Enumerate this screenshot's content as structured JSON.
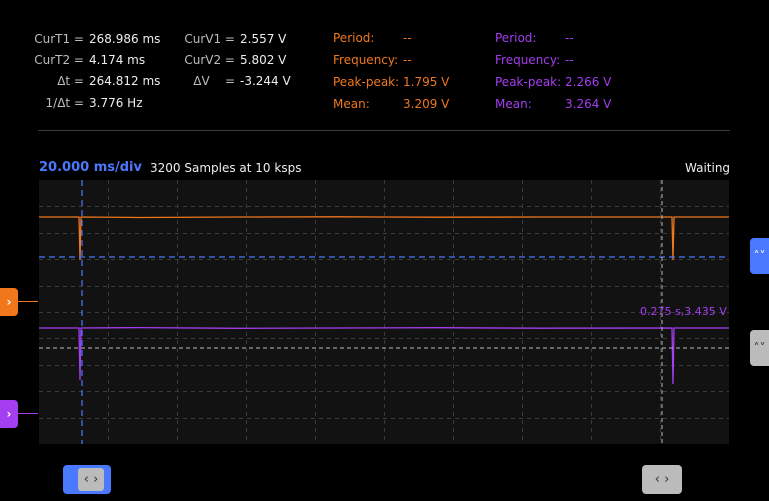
{
  "cursor_readout": {
    "curt1_label": "CurT1 =",
    "curt1_value": "268.986 ms",
    "curt2_label": "CurT2 =",
    "curt2_value": "4.174 ms",
    "dt_label": "Δt =",
    "dt_value": "264.812 ms",
    "inv_dt_label": "1/Δt =",
    "inv_dt_value": "3.776 Hz",
    "curv1_label": "CurV1 =",
    "curv1_value": "2.557 V",
    "curv2_label": "CurV2 =",
    "curv2_value": "5.802 V",
    "dv_label": "ΔV    =",
    "dv_value": "-3.244 V"
  },
  "channel1_stats": {
    "color": "#f0771c",
    "period_label": "Period:",
    "period_value": "--",
    "frequency_label": "Frequency:",
    "frequency_value": "--",
    "peakpeak_label": "Peak-peak:",
    "peakpeak_value": "1.795 V",
    "mean_label": "Mean:",
    "mean_value": "3.209 V"
  },
  "channel2_stats": {
    "color": "#a53df0",
    "period_label": "Period:",
    "period_value": "--",
    "frequency_label": "Frequency:",
    "frequency_value": "--",
    "peakpeak_label": "Peak-peak:",
    "peakpeak_value": "2.266 V",
    "mean_label": "Mean:",
    "mean_value": "3.264 V"
  },
  "scope": {
    "timebase": "20.000 ms/div",
    "samples": "3200 Samples at 10 ksps",
    "status": "Waiting",
    "cursor_annotation": "0.275 s,3.435 V",
    "accent_color": "#4a78ff",
    "grid_color": "#3a3a3a"
  },
  "controls": {
    "vertical_cursor1_button": "˄˅",
    "vertical_cursor2_button": "˄˅",
    "time_cursor1_button": "‹ ›",
    "time_cursor2_button": "‹ ›",
    "ch1_marker": "›",
    "ch2_marker": "›"
  }
}
